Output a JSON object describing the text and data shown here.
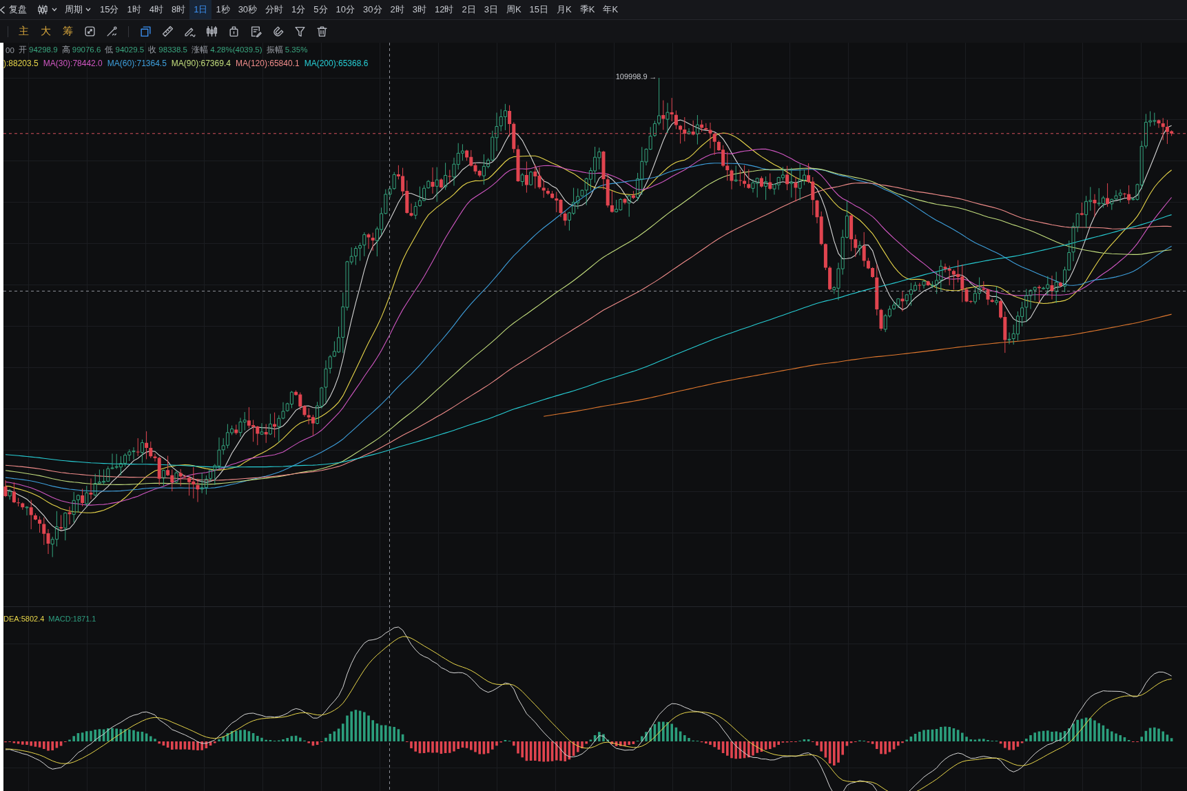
{
  "toolbar": {
    "replay_label": "复盘",
    "period_menu_label": "周期",
    "intervals": [
      {
        "label": "15分",
        "selected": false
      },
      {
        "label": "1时",
        "selected": false
      },
      {
        "label": "4时",
        "selected": false
      },
      {
        "label": "8时",
        "selected": false
      },
      {
        "label": "1日",
        "selected": true
      },
      {
        "label": "1秒",
        "selected": false
      },
      {
        "label": "30秒",
        "selected": false
      },
      {
        "label": "分时",
        "selected": false
      },
      {
        "label": "1分",
        "selected": false
      },
      {
        "label": "5分",
        "selected": false
      },
      {
        "label": "10分",
        "selected": false
      },
      {
        "label": "30分",
        "selected": false
      },
      {
        "label": "2时",
        "selected": false
      },
      {
        "label": "3时",
        "selected": false
      },
      {
        "label": "12时",
        "selected": false
      },
      {
        "label": "2日",
        "selected": false
      },
      {
        "label": "3日",
        "selected": false
      },
      {
        "label": "周K",
        "selected": false
      },
      {
        "label": "15日",
        "selected": false
      },
      {
        "label": "月K",
        "selected": false
      },
      {
        "label": "季K",
        "selected": false
      },
      {
        "label": "年K",
        "selected": false
      }
    ]
  },
  "drawing_toolbar": {
    "indicators": [
      "主",
      "大",
      "筹"
    ],
    "tool_groups": [
      [
        {
          "kind": "cycle",
          "selected": false
        },
        {
          "kind": "line",
          "selected": false
        }
      ],
      [
        {
          "kind": "frame",
          "selected": true
        },
        {
          "kind": "ruler",
          "selected": false
        },
        {
          "kind": "brush",
          "selected": false
        },
        {
          "kind": "pattern",
          "selected": false
        },
        {
          "kind": "lock",
          "selected": false
        },
        {
          "kind": "note",
          "selected": false
        },
        {
          "kind": "magnet",
          "selected": false
        },
        {
          "kind": "filter",
          "selected": false
        },
        {
          "kind": "trash",
          "selected": false
        }
      ]
    ]
  },
  "ohlc_readout": {
    "time_fragment": "00",
    "items": [
      {
        "label": "开",
        "value": "94298.9"
      },
      {
        "label": "高",
        "value": "99076.6"
      },
      {
        "label": "低",
        "value": "94029.5"
      },
      {
        "label": "收",
        "value": "98338.5"
      },
      {
        "label": "涨幅",
        "value": "4.28%(4039.5)"
      },
      {
        "label": "振幅",
        "value": "5.35%"
      }
    ]
  },
  "ma_legend": [
    {
      "text": "):88203.5",
      "color": "#e8d64a"
    },
    {
      "text": "MA(30):78442.0",
      "color": "#d157c3"
    },
    {
      "text": "MA(60):71364.5",
      "color": "#3e9fdc"
    },
    {
      "text": "MA(90):67369.4",
      "color": "#c4df7e"
    },
    {
      "text": "MA(120):65840.1",
      "color": "#f08c8a"
    },
    {
      "text": "MA(200):65368.6",
      "color": "#27cfd6"
    }
  ],
  "chart": {
    "high_marker": "109998.9 →"
  },
  "macd_legend": [
    {
      "text": "DEA:5802.4",
      "color": "#e8d64a"
    },
    {
      "text": "MACD:1871.1",
      "color": "#2e9e80"
    }
  ]
}
